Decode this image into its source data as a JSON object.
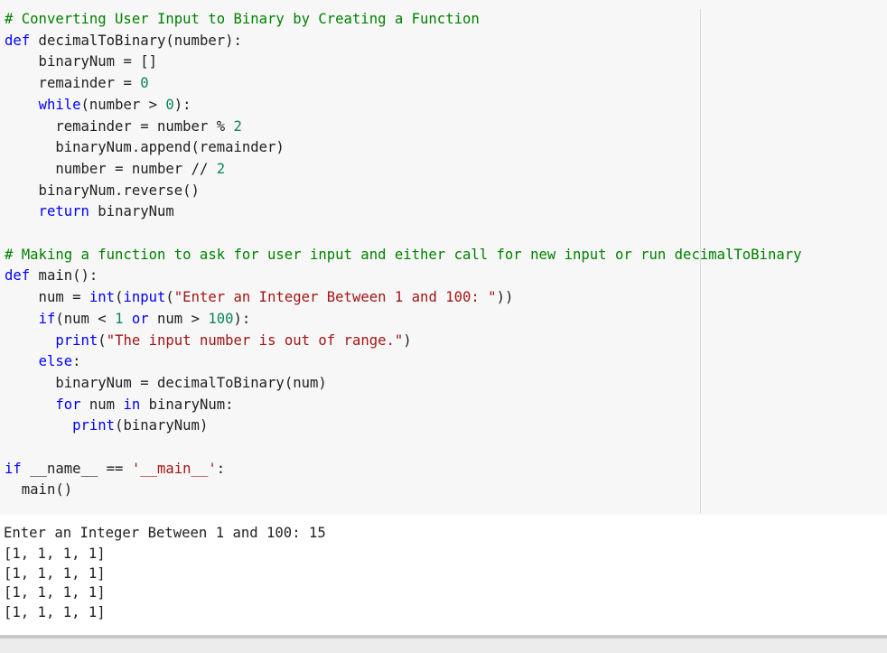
{
  "code": {
    "lines": [
      [
        {
          "t": "# Converting User Input to Binary by Creating a Function",
          "c": "comment"
        }
      ],
      [
        {
          "t": "def",
          "c": "kw"
        },
        {
          "t": " decimalToBinary",
          "c": "name"
        },
        {
          "t": "(number):",
          "c": "op"
        }
      ],
      [
        {
          "t": "    binaryNum ",
          "c": "name"
        },
        {
          "t": "=",
          "c": "op"
        },
        {
          "t": " []",
          "c": "op"
        }
      ],
      [
        {
          "t": "    remainder ",
          "c": "name"
        },
        {
          "t": "=",
          "c": "op"
        },
        {
          "t": " ",
          "c": "op"
        },
        {
          "t": "0",
          "c": "num"
        }
      ],
      [
        {
          "t": "    ",
          "c": "name"
        },
        {
          "t": "while",
          "c": "kw"
        },
        {
          "t": "(number ",
          "c": "name"
        },
        {
          "t": ">",
          "c": "op"
        },
        {
          "t": " ",
          "c": "op"
        },
        {
          "t": "0",
          "c": "num"
        },
        {
          "t": "):",
          "c": "op"
        }
      ],
      [
        {
          "t": "      remainder ",
          "c": "name"
        },
        {
          "t": "=",
          "c": "op"
        },
        {
          "t": " number ",
          "c": "name"
        },
        {
          "t": "%",
          "c": "op"
        },
        {
          "t": " ",
          "c": "op"
        },
        {
          "t": "2",
          "c": "num"
        }
      ],
      [
        {
          "t": "      binaryNum.append(remainder)",
          "c": "name"
        }
      ],
      [
        {
          "t": "      number ",
          "c": "name"
        },
        {
          "t": "=",
          "c": "op"
        },
        {
          "t": " number ",
          "c": "name"
        },
        {
          "t": "//",
          "c": "op"
        },
        {
          "t": " ",
          "c": "op"
        },
        {
          "t": "2",
          "c": "num"
        }
      ],
      [
        {
          "t": "    binaryNum.reverse()",
          "c": "name"
        }
      ],
      [
        {
          "t": "    ",
          "c": "name"
        },
        {
          "t": "return",
          "c": "kw"
        },
        {
          "t": " binaryNum",
          "c": "name"
        }
      ],
      [],
      [
        {
          "t": "# Making a function to ask for user input and either call for new input or run decimalToBinary",
          "c": "comment"
        }
      ],
      [
        {
          "t": "def",
          "c": "kw"
        },
        {
          "t": " main",
          "c": "name"
        },
        {
          "t": "():",
          "c": "op"
        }
      ],
      [
        {
          "t": "    num ",
          "c": "name"
        },
        {
          "t": "=",
          "c": "op"
        },
        {
          "t": " ",
          "c": "op"
        },
        {
          "t": "int",
          "c": "kw"
        },
        {
          "t": "(",
          "c": "op"
        },
        {
          "t": "input",
          "c": "kw"
        },
        {
          "t": "(",
          "c": "op"
        },
        {
          "t": "\"Enter an Integer Between 1 and 100: \"",
          "c": "str"
        },
        {
          "t": "))",
          "c": "op"
        }
      ],
      [
        {
          "t": "    ",
          "c": "name"
        },
        {
          "t": "if",
          "c": "kw"
        },
        {
          "t": "(num ",
          "c": "name"
        },
        {
          "t": "<",
          "c": "op"
        },
        {
          "t": " ",
          "c": "op"
        },
        {
          "t": "1",
          "c": "num"
        },
        {
          "t": " ",
          "c": "op"
        },
        {
          "t": "or",
          "c": "kw"
        },
        {
          "t": " num ",
          "c": "name"
        },
        {
          "t": ">",
          "c": "op"
        },
        {
          "t": " ",
          "c": "op"
        },
        {
          "t": "100",
          "c": "num"
        },
        {
          "t": "):",
          "c": "op"
        }
      ],
      [
        {
          "t": "      ",
          "c": "name"
        },
        {
          "t": "print",
          "c": "kw"
        },
        {
          "t": "(",
          "c": "op"
        },
        {
          "t": "\"The input number is out of range.\"",
          "c": "str"
        },
        {
          "t": ")",
          "c": "op"
        }
      ],
      [
        {
          "t": "    ",
          "c": "name"
        },
        {
          "t": "else",
          "c": "kw"
        },
        {
          "t": ":",
          "c": "op"
        }
      ],
      [
        {
          "t": "      binaryNum ",
          "c": "name"
        },
        {
          "t": "=",
          "c": "op"
        },
        {
          "t": " decimalToBinary(num)",
          "c": "name"
        }
      ],
      [
        {
          "t": "      ",
          "c": "name"
        },
        {
          "t": "for",
          "c": "kw"
        },
        {
          "t": " num ",
          "c": "name"
        },
        {
          "t": "in",
          "c": "kw"
        },
        {
          "t": " binaryNum:",
          "c": "name"
        }
      ],
      [
        {
          "t": "        ",
          "c": "name"
        },
        {
          "t": "print",
          "c": "kw"
        },
        {
          "t": "(binaryNum)",
          "c": "name"
        }
      ],
      [],
      [
        {
          "t": "if",
          "c": "kw"
        },
        {
          "t": " __name__ ",
          "c": "name"
        },
        {
          "t": "==",
          "c": "op"
        },
        {
          "t": " ",
          "c": "op"
        },
        {
          "t": "'__main__'",
          "c": "str"
        },
        {
          "t": ":",
          "c": "op"
        }
      ],
      [
        {
          "t": "  main()",
          "c": "name"
        }
      ]
    ]
  },
  "output": {
    "lines": [
      "Enter an Integer Between 1 and 100: 15",
      "[1, 1, 1, 1]",
      "[1, 1, 1, 1]",
      "[1, 1, 1, 1]",
      "[1, 1, 1, 1]"
    ]
  },
  "colors": {
    "comment": "#008000",
    "keyword": "#0000ff",
    "number": "#098658",
    "string": "#a31515",
    "cell_background": "#f7f7f7",
    "output_background": "#ffffff"
  }
}
